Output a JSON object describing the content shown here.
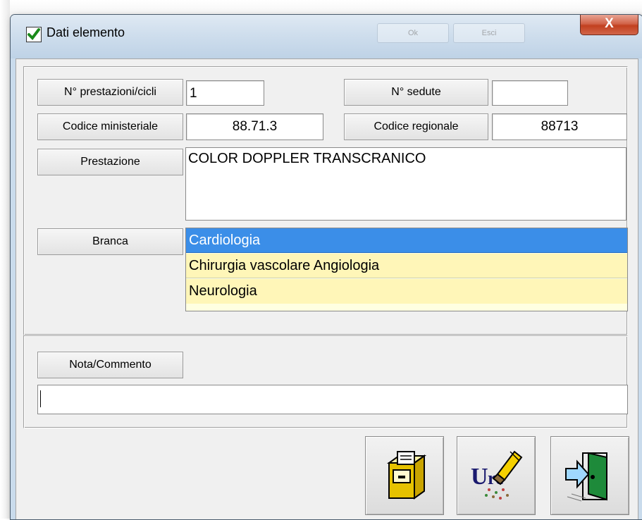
{
  "window": {
    "title": "Dati elemento",
    "close_glyph": "X",
    "ghost_buttons": [
      "Ok",
      "Esci"
    ]
  },
  "fields": {
    "n_prestazioni_label": "N° prestazioni/cicli",
    "n_prestazioni_value": "1",
    "n_sedute_label": "N° sedute",
    "n_sedute_value": "",
    "codice_ministeriale_label": "Codice ministeriale",
    "codice_ministeriale_value": "88.71.3",
    "codice_regionale_label": "Codice regionale",
    "codice_regionale_value": "88713",
    "prestazione_label": "Prestazione",
    "prestazione_value": "COLOR DOPPLER TRANSCRANICO"
  },
  "branca": {
    "label": "Branca",
    "items": [
      "Cardiologia",
      "Chirurgia vascolare Angiologia",
      "Neurologia"
    ],
    "selected_index": 0
  },
  "nota": {
    "label": "Nota/Commento",
    "value": ""
  },
  "actions": [
    {
      "name": "save-button",
      "icon": "save-cabinet-icon"
    },
    {
      "name": "delete-button",
      "icon": "eraser-icon"
    },
    {
      "name": "exit-button",
      "icon": "exit-door-icon"
    }
  ],
  "colors": {
    "selected_item": "#3b8ee8",
    "list_background": "#fff6b8",
    "close_button": "#c2401f"
  }
}
